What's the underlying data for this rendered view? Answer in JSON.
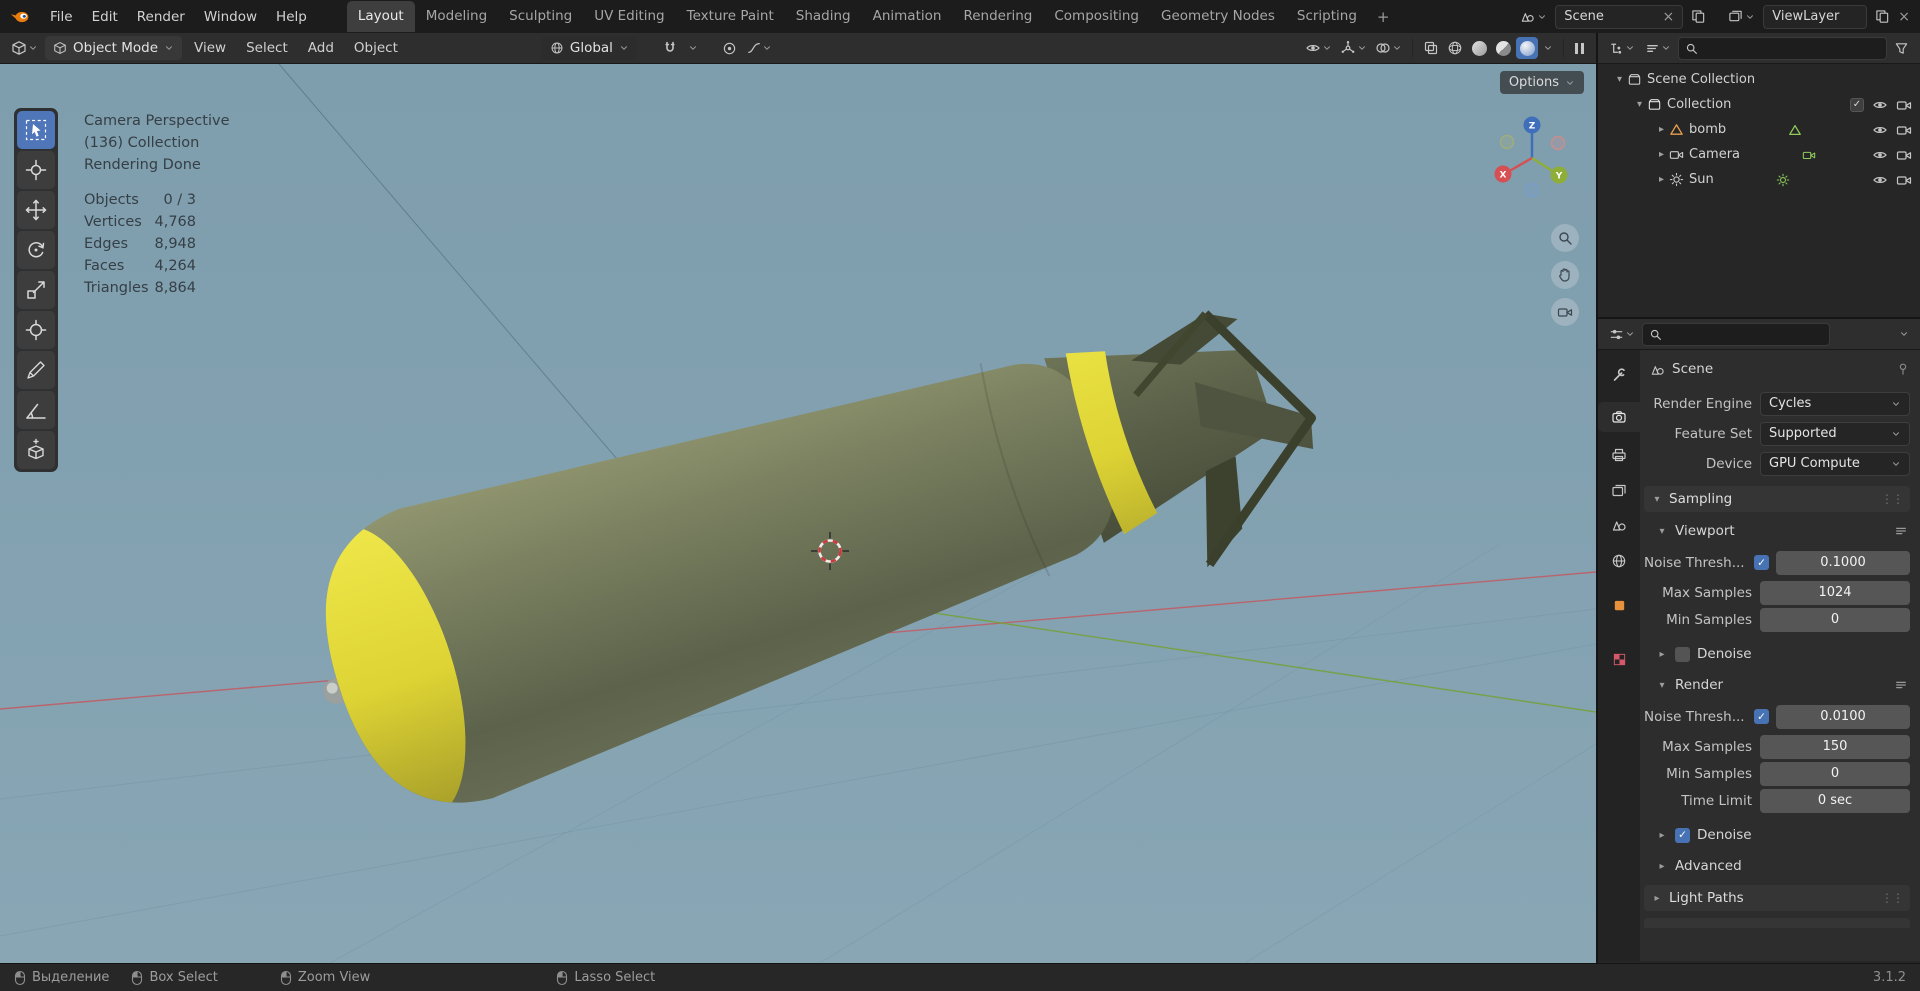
{
  "topbar": {
    "menus": [
      "File",
      "Edit",
      "Render",
      "Window",
      "Help"
    ],
    "workspaces": [
      "Layout",
      "Modeling",
      "Sculpting",
      "UV Editing",
      "Texture Paint",
      "Shading",
      "Animation",
      "Rendering",
      "Compositing",
      "Geometry Nodes",
      "Scripting"
    ],
    "new_workspace": "+",
    "scene_field": "Scene",
    "viewlayer_field": "ViewLayer"
  },
  "vp_header": {
    "mode": "Object Mode",
    "menu_view": "View",
    "menu_select": "Select",
    "menu_add": "Add",
    "menu_object": "Object",
    "orientation": "Global",
    "options": "Options"
  },
  "vp_overlay": {
    "camera": "Camera Perspective",
    "collection": "(136) Collection",
    "status": "Rendering Done",
    "stats": [
      {
        "k": "Objects",
        "v": "0 / 3"
      },
      {
        "k": "Vertices",
        "v": "4,768"
      },
      {
        "k": "Edges",
        "v": "8,948"
      },
      {
        "k": "Faces",
        "v": "4,264"
      },
      {
        "k": "Triangles",
        "v": "8,864"
      }
    ],
    "axis_x": "X",
    "axis_y": "Y",
    "axis_z": "Z"
  },
  "outliner": {
    "rows": {
      "scene_collection": "Scene Collection",
      "collection": "Collection",
      "bomb": "bomb",
      "camera": "Camera",
      "sun": "Sun"
    }
  },
  "props": {
    "breadcrumb": "Scene",
    "render_engine_label": "Render Engine",
    "render_engine": "Cycles",
    "feature_set_label": "Feature Set",
    "feature_set": "Supported",
    "device_label": "Device",
    "device": "GPU Compute",
    "sampling": "Sampling",
    "viewport": "Viewport",
    "render": "Render",
    "noise_label": "Noise Thresh...",
    "max_label": "Max Samples",
    "min_label": "Min Samples",
    "time_label": "Time Limit",
    "denoise": "Denoise",
    "advanced": "Advanced",
    "light_paths": "Light Paths",
    "vp_noise": "0.1000",
    "vp_max": "1024",
    "vp_min": "0",
    "r_noise": "0.0100",
    "r_max": "150",
    "r_min": "0",
    "r_time": "0 sec"
  },
  "status": {
    "hint1": "Выделение",
    "hint2": "Box Select",
    "hint3": "Zoom View",
    "hint4": "Lasso Select",
    "version": "3.1.2"
  },
  "colors": {
    "accent": "#4772b3",
    "viewport_bg": "#84a2b1",
    "bomb_body": "#707659",
    "bomb_nose": "#e4dc3c",
    "axis_x": "#cf4f54",
    "axis_y": "#8fae38",
    "axis_z": "#3f6fba"
  }
}
